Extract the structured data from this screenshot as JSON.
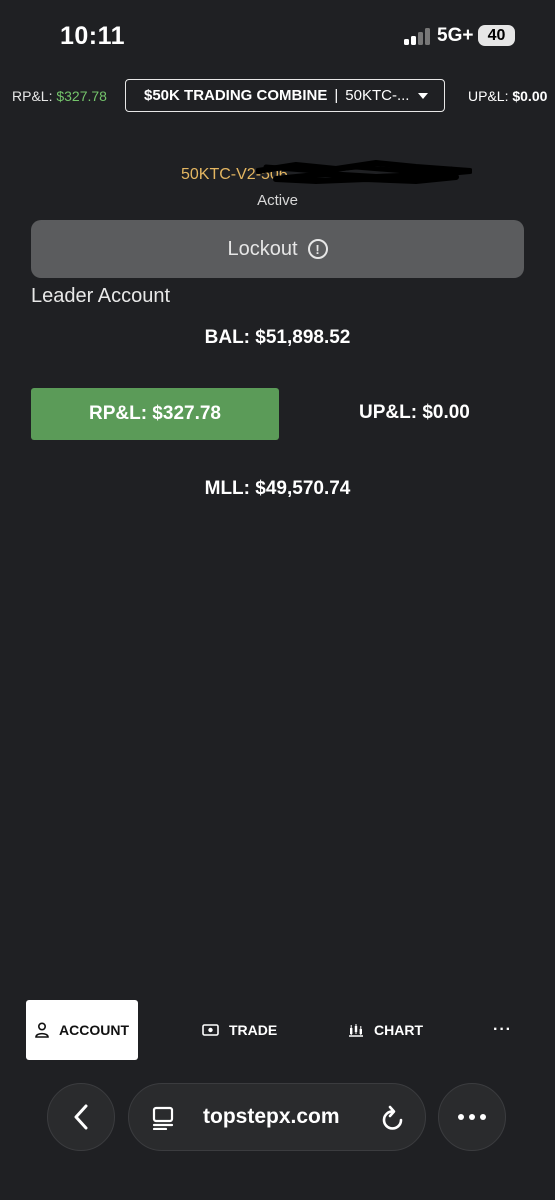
{
  "status_bar": {
    "time": "10:11",
    "network": "5G+",
    "battery": "40"
  },
  "topbar": {
    "rpl_label": "RP&L:",
    "rpl_value": "$327.78",
    "account_name": "$50K TRADING COMBINE",
    "separator": "|",
    "account_id_short": "50KTC-...",
    "upl_label": "UP&L:",
    "upl_value": "$0.00"
  },
  "account": {
    "id": "50KTC-V2-506",
    "status": "Active",
    "lockout_label": "Lockout",
    "type": "Leader Account",
    "balance": "BAL: $51,898.52",
    "rpl": "RP&L: $327.78",
    "upl": "UP&L: $0.00",
    "mll": "MLL: $49,570.74"
  },
  "bottom_nav": {
    "items": [
      {
        "label": "ACCOUNT",
        "icon": "person-icon",
        "active": true
      },
      {
        "label": "TRADE",
        "icon": "cash-icon",
        "active": false
      },
      {
        "label": "CHART",
        "icon": "candlestick-icon",
        "active": false
      },
      {
        "label": "···",
        "icon": "more-icon",
        "active": false
      }
    ]
  },
  "browser": {
    "url": "topstepx.com"
  },
  "colors": {
    "background": "#1f2023",
    "positive_green": "#5b9b58",
    "account_id_gold": "#e4b661",
    "lockout_gray": "#5b5c5e"
  }
}
